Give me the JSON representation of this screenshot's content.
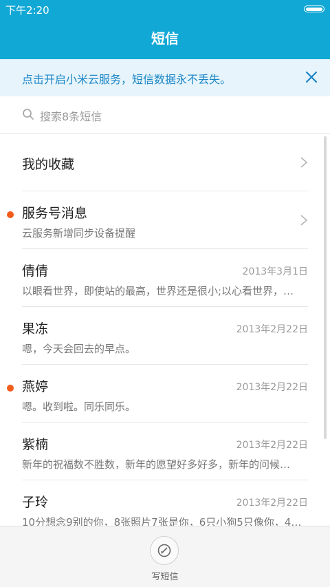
{
  "status": {
    "time": "下午2:20"
  },
  "header": {
    "title": "短信"
  },
  "banner": {
    "text": "点击开启小米云服务，短信数据永不丢失。"
  },
  "search": {
    "placeholder": "搜索8条短信"
  },
  "rows": [
    {
      "title": "我的收藏"
    },
    {
      "title": "服务号消息",
      "subtitle": "云服务新增同步设备提醒",
      "unread": true
    },
    {
      "title": "倩倩",
      "subtitle": "以眼看世界，即使站的最高，世界还是很小;以心看世界，…",
      "date": "2013年3月1日"
    },
    {
      "title": "果冻",
      "subtitle": "嗯，今天会回去的早点。",
      "date": "2013年2月22日"
    },
    {
      "title": "燕婷",
      "subtitle": "嗯。收到啦。同乐同乐。",
      "date": "2013年2月22日",
      "unread": true
    },
    {
      "title": "紫楠",
      "subtitle": "新年的祝福数不胜数，新年的愿望好多好多，新年的问候…",
      "date": "2013年2月22日"
    },
    {
      "title": "子玲",
      "subtitle": "10分想念9别的你，8张照片7张是你，6只小狗5只像你，4…",
      "date": "2013年2月22日"
    }
  ],
  "bottom": {
    "compose_label": "写短信"
  },
  "colors": {
    "accent": "#12A8D6",
    "unread_dot": "#F25B1A",
    "banner_text": "#1A86C8"
  }
}
